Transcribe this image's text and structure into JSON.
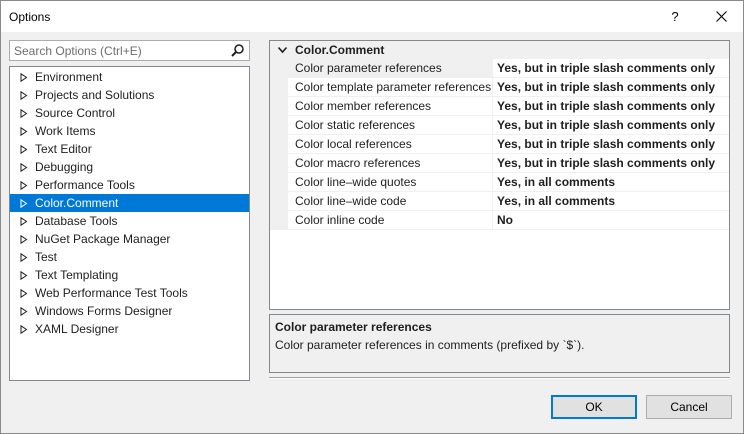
{
  "window": {
    "title": "Options",
    "help_label": "?"
  },
  "search": {
    "placeholder": "Search Options (Ctrl+E)"
  },
  "tree": {
    "items": [
      {
        "label": "Environment",
        "selected": false
      },
      {
        "label": "Projects and Solutions",
        "selected": false
      },
      {
        "label": "Source Control",
        "selected": false
      },
      {
        "label": "Work Items",
        "selected": false
      },
      {
        "label": "Text Editor",
        "selected": false
      },
      {
        "label": "Debugging",
        "selected": false
      },
      {
        "label": "Performance Tools",
        "selected": false
      },
      {
        "label": "Color.Comment",
        "selected": true
      },
      {
        "label": "Database Tools",
        "selected": false
      },
      {
        "label": "NuGet Package Manager",
        "selected": false
      },
      {
        "label": "Test",
        "selected": false
      },
      {
        "label": "Text Templating",
        "selected": false
      },
      {
        "label": "Web Performance Test Tools",
        "selected": false
      },
      {
        "label": "Windows Forms Designer",
        "selected": false
      },
      {
        "label": "XAML Designer",
        "selected": false
      }
    ]
  },
  "grid": {
    "category": "Color.Comment",
    "properties": [
      {
        "name": "Color parameter references",
        "value": "Yes, but in triple slash comments only",
        "selected": true
      },
      {
        "name": "Color template parameter references",
        "value": "Yes, but in triple slash comments only",
        "selected": false
      },
      {
        "name": "Color member references",
        "value": "Yes, but in triple slash comments only",
        "selected": false
      },
      {
        "name": "Color static references",
        "value": "Yes, but in triple slash comments only",
        "selected": false
      },
      {
        "name": "Color local references",
        "value": "Yes, but in triple slash comments only",
        "selected": false
      },
      {
        "name": "Color macro references",
        "value": "Yes, but in triple slash comments only",
        "selected": false
      },
      {
        "name": "Color line–wide quotes",
        "value": "Yes, in all comments",
        "selected": false
      },
      {
        "name": "Color line–wide code",
        "value": "Yes, in all comments",
        "selected": false
      },
      {
        "name": "Color inline code",
        "value": "No",
        "selected": false
      }
    ]
  },
  "description": {
    "title": "Color parameter references",
    "text": "Color parameter references in comments (prefixed by `$`)."
  },
  "buttons": {
    "ok": "OK",
    "cancel": "Cancel"
  },
  "colors": {
    "selection": "#0078d7",
    "panel": "#f0f0f0"
  },
  "icons": {
    "search": "search-icon",
    "close": "close-icon",
    "expand": "triangle-right-icon",
    "collapse": "chevron-down-icon"
  }
}
